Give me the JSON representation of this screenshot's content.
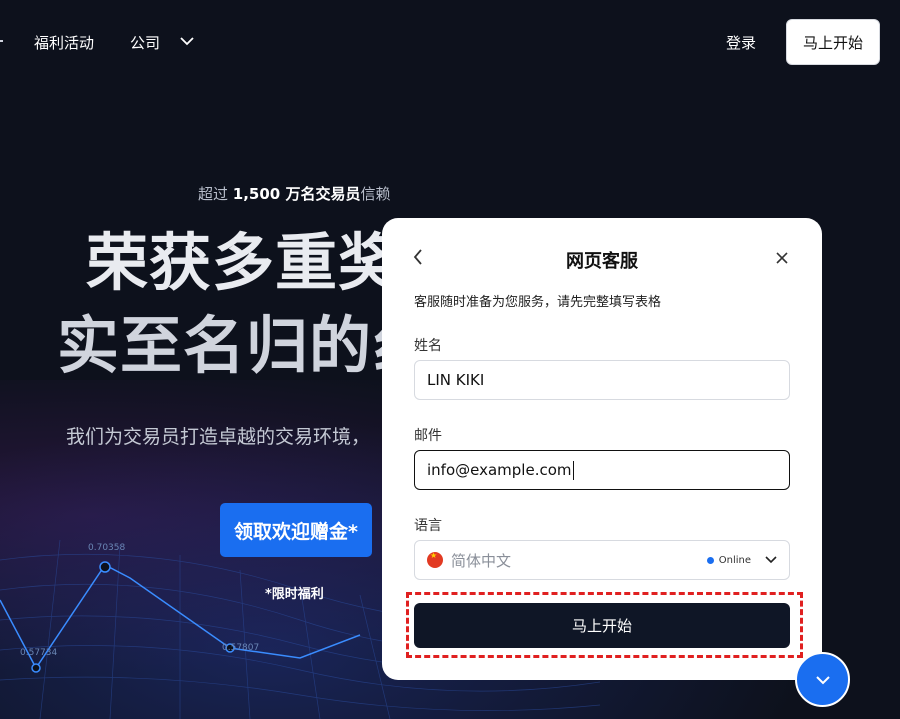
{
  "nav": {
    "welfare": "福利活动",
    "company": "公司",
    "login": "登录",
    "start": "马上开始"
  },
  "hero": {
    "trust_prefix": "超过 ",
    "trust_bold": "1,500 万名交易员",
    "trust_suffix": "信赖",
    "title_line1": "荣获多重奖",
    "title_line2": "实至名归的纟",
    "subtitle": "我们为交易员打造卓越的交易环境，",
    "bonus_button": "领取欢迎赠金*",
    "limited": "*限时福利",
    "chart_labels": [
      "0.70358",
      "0.57734",
      "0.57807"
    ]
  },
  "chat": {
    "title": "网页客服",
    "description": "客服随时准备为您服务，请先完整填写表格",
    "name_label": "姓名",
    "name_value": "LIN KIKI",
    "email_label": "邮件",
    "email_value": "info@example.com",
    "language_label": "语言",
    "language_value": "简体中文",
    "status": "Online",
    "submit": "马上开始"
  },
  "colors": {
    "background": "#0d111c",
    "accent": "#1a6ef0",
    "submit_bg": "#0f1626",
    "highlight": "#e02020"
  },
  "icons": {
    "back": "chevron-left-icon",
    "close": "close-icon",
    "company_dropdown": "chevron-down-icon",
    "language_dropdown": "chevron-down-icon",
    "flag": "china-flag-icon",
    "fab": "chevron-down-icon"
  }
}
